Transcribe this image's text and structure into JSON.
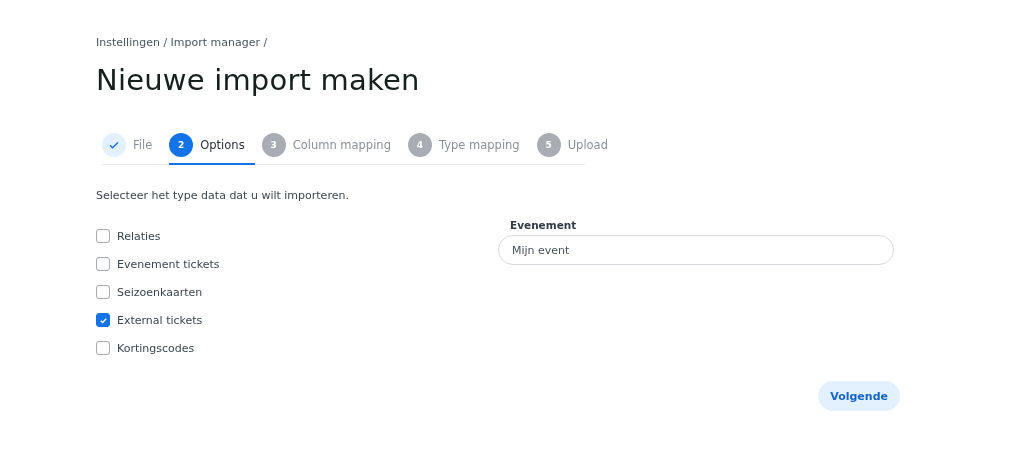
{
  "breadcrumb": "Instellingen / Import manager /",
  "title": "Nieuwe import maken",
  "steps": [
    {
      "label": "File",
      "kind": "done",
      "selected": false
    },
    {
      "number": "2",
      "label": "Options",
      "kind": "active",
      "selected": true
    },
    {
      "number": "3",
      "label": "Column mapping",
      "kind": "pending",
      "selected": false
    },
    {
      "number": "4",
      "label": "Type mapping",
      "kind": "pending",
      "selected": false
    },
    {
      "number": "5",
      "label": "Upload",
      "kind": "pending",
      "selected": false
    }
  ],
  "instruction": "Selecteer het type data dat u wilt importeren.",
  "data_types": [
    {
      "label": "Relaties",
      "checked": false
    },
    {
      "label": "Evenement tickets",
      "checked": false
    },
    {
      "label": "Seizoenkaarten",
      "checked": false
    },
    {
      "label": "External tickets",
      "checked": true
    },
    {
      "label": "Kortingscodes",
      "checked": false
    }
  ],
  "event_field": {
    "label": "Evenement",
    "value": "Mijn event"
  },
  "next_button": "Volgende"
}
